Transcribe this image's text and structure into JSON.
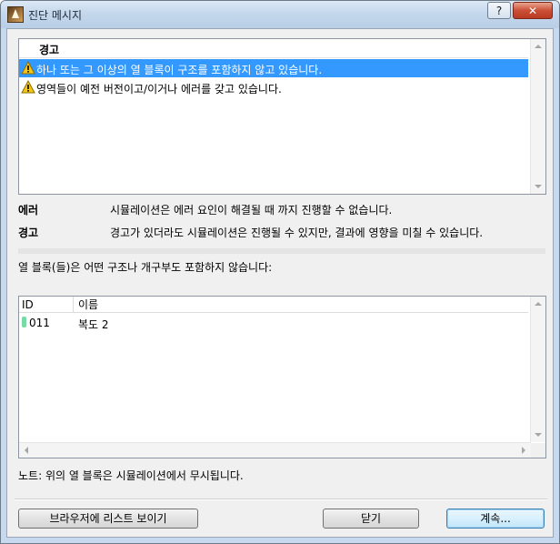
{
  "window": {
    "title": "진단 메시지",
    "help_label": "?",
    "close_label": "✕"
  },
  "warnings": {
    "header": "경고",
    "items": [
      "하나 또는 그 이상의 열 블록이 구조를 포함하지 않고 있습니다.",
      "영역들이 예전 버전이고/이거나 에러를 갖고 있습니다."
    ],
    "selected_index": 0
  },
  "legend": {
    "error_label": "에러",
    "error_desc": "시뮬레이션은 에러 요인이 해결될 때 까지 진행할 수 없습니다.",
    "warning_label": "경고",
    "warning_desc": "경고가 있더라도 시뮬레이션은 진행될 수 있지만, 결과에 영향을 미칠 수 있습니다."
  },
  "message": "열 블록(들)은 어떤 구조나 개구부도 포함하지 않습니다:",
  "table": {
    "columns": [
      "ID",
      "이름"
    ],
    "rows": [
      {
        "id": "011",
        "name": "복도 2",
        "marker_color": "#78dba4"
      }
    ]
  },
  "note": "노트: 위의 열 블록은 시뮬레이션에서 무시됩니다.",
  "buttons": {
    "browser_list": "브라우저에 리스트 보이기",
    "close": "닫기",
    "continue": "계속..."
  },
  "colors": {
    "selection": "#3399ff",
    "warning_icon": "#f5c518"
  }
}
